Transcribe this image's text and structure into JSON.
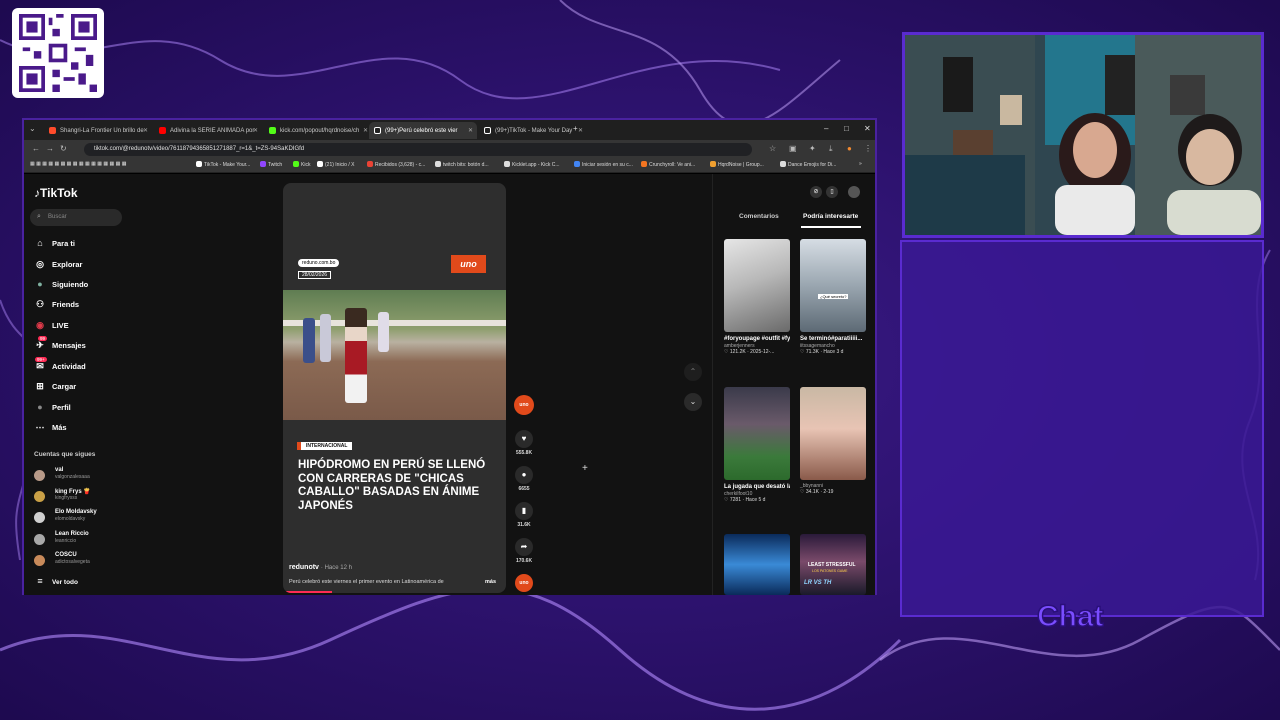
{
  "browser": {
    "tabs": [
      {
        "label": "Shangri-La Frontier Un brillo de",
        "color": "#ff4b2b",
        "active": false
      },
      {
        "label": "Adivina la SERIE ANIMADA por",
        "color": "#ff0000",
        "active": false
      },
      {
        "label": "kick.com/popout/hqrdnoise/ch",
        "color": "#53fc18",
        "active": false
      },
      {
        "label": "(99+)Perú celebró este vier",
        "color": "#ffffff",
        "active": true
      },
      {
        "label": "(99+)TikTok - Make Your Day",
        "color": "#ffffff",
        "active": false
      }
    ],
    "new_tab": "+",
    "minimize": "–",
    "maximize": "□",
    "close": "✕",
    "url": "tiktok.com/@redunotv/video/7611879436585127​1887_r=1&_t=ZS-94SaKDIGfd",
    "bookmarks": [
      {
        "label": "TikTok - Make Your...",
        "color": "#ffffff"
      },
      {
        "label": "Twitch",
        "color": "#9146ff"
      },
      {
        "label": "Kick",
        "color": "#53fc18"
      },
      {
        "label": "(21) Inicio / X",
        "color": "#ffffff"
      },
      {
        "label": "Recibidos (3,628) - c...",
        "color": "#ea4335"
      },
      {
        "label": "twitch bits: botón d...",
        "color": "#dddddd"
      },
      {
        "label": "Kicklet.app - Kick C...",
        "color": "#dddddd"
      },
      {
        "label": "Iniciar sesión en su c...",
        "color": "#4285f4"
      },
      {
        "label": "Crunchyroll: Ve ani...",
        "color": "#f47521"
      },
      {
        "label": "HqrdNoise | Group...",
        "color": "#f0a030"
      },
      {
        "label": "Dance Emojis for Di...",
        "color": "#dddddd"
      }
    ]
  },
  "tiktok": {
    "logo": "TikTok",
    "search_placeholder": "Buscar",
    "nav": [
      {
        "label": "Para ti",
        "icon": "home-icon"
      },
      {
        "label": "Explorar",
        "icon": "compass-icon"
      },
      {
        "label": "Siguiendo",
        "icon": "following-icon"
      },
      {
        "label": "Friends",
        "icon": "friends-icon"
      },
      {
        "label": "LIVE",
        "icon": "live-icon"
      },
      {
        "label": "Mensajes",
        "icon": "messages-icon",
        "badge": "99"
      },
      {
        "label": "Actividad",
        "icon": "activity-icon",
        "badge": "99+"
      },
      {
        "label": "Cargar",
        "icon": "upload-icon"
      },
      {
        "label": "Perfil",
        "icon": "profile-icon"
      },
      {
        "label": "Más",
        "icon": "more-icon"
      }
    ],
    "following_title": "Cuentas que sigues",
    "following": [
      {
        "name": "val",
        "handle": "valgonzalesaaa"
      },
      {
        "name": "king Frys 🍟",
        "handle": "kingfrysss"
      },
      {
        "name": "Elo Moldavsky",
        "handle": "elomoldavsky"
      },
      {
        "name": "Lean Riccio",
        "handle": "leanriccio"
      },
      {
        "name": "COSCU",
        "handle": "adictosalvegeta"
      }
    ],
    "see_all": "Ver todo",
    "video": {
      "source": "reduno.com.bo",
      "date": "28/02/2026",
      "channel_logo": "uno",
      "tag": "INTERNACIONAL",
      "headline": "HIPÓDROMO EN PERÚ SE LLENÓ CON CARRERAS DE \"CHICAS CABALLO\" BASADAS EN ÁNIME JAPONÉS",
      "user": "redunotv",
      "time": "· Hace 12 h",
      "description": "Perú celebró este viernes el primer evento en Latinoamérica de",
      "more": "más",
      "progress": 0.22
    },
    "actions": {
      "likes": "555.8K",
      "comments": "6655",
      "saves": "31.6K",
      "shares": "170.6K",
      "avatar_text": "uno"
    },
    "right_tabs": {
      "comments": "Comentarios",
      "interest": "Podría interesarte"
    },
    "cards": [
      {
        "caption": "#foryoupage #outfit #fyp...",
        "author": "amberjenners",
        "meta": "♡ 121.2K · 2025-12-..."
      },
      {
        "caption": "Se terminó#paratiiiii...",
        "author": "iitssagemancho",
        "meta": "♡ 71.3K · Hace 3 d"
      },
      {
        "caption": "La jugada que desató la...",
        "author": "cherkilfoot10",
        "meta": "♡ 7281 · Hace 5 d"
      },
      {
        "caption": "",
        "author": "_bbynanni",
        "meta": "♡ 34.1K · 2-19"
      },
      {
        "caption": "",
        "author": "",
        "meta": ""
      },
      {
        "caption": "LEAST STRESSFUL",
        "author": "",
        "meta": ""
      }
    ],
    "card_overlay_1": "¿Qué secreto?",
    "card_overlay_6": "LOS PATONES GAME",
    "card_overlay_6b": "LR VS TH"
  },
  "stream": {
    "chat_label": "Chat"
  }
}
